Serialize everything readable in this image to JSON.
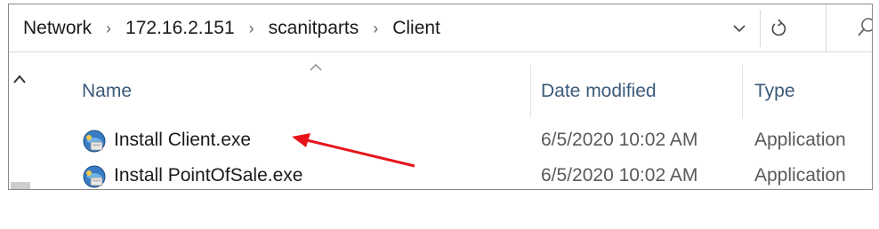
{
  "address_bar": {
    "breadcrumbs": [
      "Network",
      "172.16.2.151",
      "scanitparts",
      "Client"
    ],
    "separator_icon": "chevron-right-icon",
    "dropdown_icon": "chevron-down-icon",
    "refresh_icon": "refresh-icon",
    "search_icon": "search-icon"
  },
  "columns": {
    "name": "Name",
    "date_modified": "Date modified",
    "type": "Type"
  },
  "files": [
    {
      "name": "Install Client.exe",
      "date_modified": "6/5/2020 10:02 AM",
      "type": "Application",
      "icon": "installer-icon"
    },
    {
      "name": "Install PointOfSale.exe",
      "date_modified": "6/5/2020 10:02 AM",
      "type": "Application",
      "icon": "installer-icon"
    }
  ],
  "annotation": {
    "arrow_color": "#e8141b"
  }
}
